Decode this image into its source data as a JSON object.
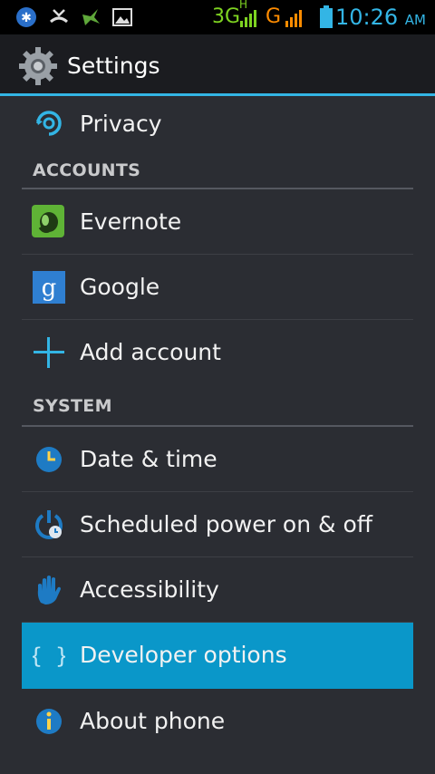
{
  "status_bar": {
    "network_3g": "3G",
    "hplus": "H",
    "network_g": "G",
    "time": "10:26",
    "ampm": "AM",
    "icons": [
      "bluetooth-icon",
      "missed-call-icon",
      "hummingbird-icon",
      "image-icon",
      "signal-icon",
      "battery-icon"
    ]
  },
  "app_bar": {
    "title": "Settings",
    "icon": "settings-gear-icon"
  },
  "items": {
    "privacy": "Privacy",
    "accounts_header": "ACCOUNTS",
    "evernote": "Evernote",
    "google": "Google",
    "add_account": "Add account",
    "system_header": "SYSTEM",
    "date_time": "Date & time",
    "scheduled_power": "Scheduled power on & off",
    "accessibility": "Accessibility",
    "developer_options": "Developer options",
    "about_phone": "About phone"
  },
  "colors": {
    "accent": "#33b5e5",
    "selected_row": "#0a97c9",
    "background": "#2b2d33"
  }
}
